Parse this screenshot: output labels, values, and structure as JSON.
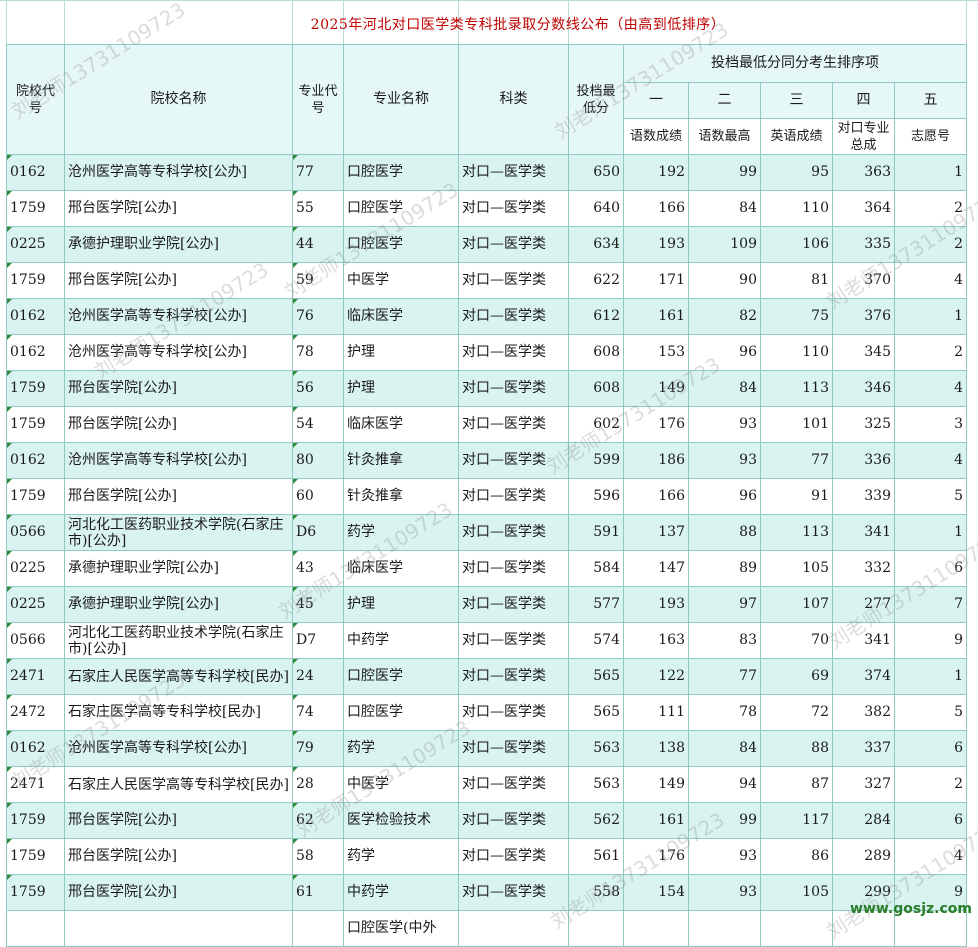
{
  "title": "2025年河北对口医学类专科批录取分数线公布（由高到低排序）",
  "header": {
    "school_code": "院校代号",
    "school_name": "院校名称",
    "major_code": "专业代号",
    "major_name": "专业名称",
    "subject": "科类",
    "min_score": "投档最低分",
    "tie_group": "投档最低分同分考生排序项",
    "orders": [
      "一",
      "二",
      "三",
      "四",
      "五"
    ],
    "order_items": [
      "语数成绩",
      "语数最高",
      "英语成绩",
      "对口专业总成",
      "志愿号"
    ]
  },
  "rows": [
    {
      "school_code": "0162",
      "school_name": "沧州医学高等专科学校[公办]",
      "major_code": "77",
      "major_name": "口腔医学",
      "subject": "对口—医学类",
      "min_score": "650",
      "c1": "192",
      "c2": "99",
      "c3": "95",
      "c4": "363",
      "c5": "1"
    },
    {
      "school_code": "1759",
      "school_name": "邢台医学院[公办]",
      "major_code": "55",
      "major_name": "口腔医学",
      "subject": "对口—医学类",
      "min_score": "640",
      "c1": "166",
      "c2": "84",
      "c3": "110",
      "c4": "364",
      "c5": "2"
    },
    {
      "school_code": "0225",
      "school_name": "承德护理职业学院[公办]",
      "major_code": "44",
      "major_name": "口腔医学",
      "subject": "对口—医学类",
      "min_score": "634",
      "c1": "193",
      "c2": "109",
      "c3": "106",
      "c4": "335",
      "c5": "2"
    },
    {
      "school_code": "1759",
      "school_name": "邢台医学院[公办]",
      "major_code": "59",
      "major_name": "中医学",
      "subject": "对口—医学类",
      "min_score": "622",
      "c1": "171",
      "c2": "90",
      "c3": "81",
      "c4": "370",
      "c5": "4"
    },
    {
      "school_code": "0162",
      "school_name": "沧州医学高等专科学校[公办]",
      "major_code": "76",
      "major_name": "临床医学",
      "subject": "对口—医学类",
      "min_score": "612",
      "c1": "161",
      "c2": "82",
      "c3": "75",
      "c4": "376",
      "c5": "1"
    },
    {
      "school_code": "0162",
      "school_name": "沧州医学高等专科学校[公办]",
      "major_code": "78",
      "major_name": "护理",
      "subject": "对口—医学类",
      "min_score": "608",
      "c1": "153",
      "c2": "96",
      "c3": "110",
      "c4": "345",
      "c5": "2"
    },
    {
      "school_code": "1759",
      "school_name": "邢台医学院[公办]",
      "major_code": "56",
      "major_name": "护理",
      "subject": "对口—医学类",
      "min_score": "608",
      "c1": "149",
      "c2": "84",
      "c3": "113",
      "c4": "346",
      "c5": "4"
    },
    {
      "school_code": "1759",
      "school_name": "邢台医学院[公办]",
      "major_code": "54",
      "major_name": "临床医学",
      "subject": "对口—医学类",
      "min_score": "602",
      "c1": "176",
      "c2": "93",
      "c3": "101",
      "c4": "325",
      "c5": "3"
    },
    {
      "school_code": "0162",
      "school_name": "沧州医学高等专科学校[公办]",
      "major_code": "80",
      "major_name": "针灸推拿",
      "subject": "对口—医学类",
      "min_score": "599",
      "c1": "186",
      "c2": "93",
      "c3": "77",
      "c4": "336",
      "c5": "4"
    },
    {
      "school_code": "1759",
      "school_name": "邢台医学院[公办]",
      "major_code": "60",
      "major_name": "针灸推拿",
      "subject": "对口—医学类",
      "min_score": "596",
      "c1": "166",
      "c2": "96",
      "c3": "91",
      "c4": "339",
      "c5": "5"
    },
    {
      "school_code": "0566",
      "school_name": "河北化工医药职业技术学院(石家庄市)[公办]",
      "major_code": "D6",
      "major_name": "药学",
      "subject": "对口—医学类",
      "min_score": "591",
      "c1": "137",
      "c2": "88",
      "c3": "113",
      "c4": "341",
      "c5": "1"
    },
    {
      "school_code": "0225",
      "school_name": "承德护理职业学院[公办]",
      "major_code": "43",
      "major_name": "临床医学",
      "subject": "对口—医学类",
      "min_score": "584",
      "c1": "147",
      "c2": "89",
      "c3": "105",
      "c4": "332",
      "c5": "6"
    },
    {
      "school_code": "0225",
      "school_name": "承德护理职业学院[公办]",
      "major_code": "45",
      "major_name": "护理",
      "subject": "对口—医学类",
      "min_score": "577",
      "c1": "193",
      "c2": "97",
      "c3": "107",
      "c4": "277",
      "c5": "7"
    },
    {
      "school_code": "0566",
      "school_name": "河北化工医药职业技术学院(石家庄市)[公办]",
      "major_code": "D7",
      "major_name": "中药学",
      "subject": "对口—医学类",
      "min_score": "574",
      "c1": "163",
      "c2": "83",
      "c3": "70",
      "c4": "341",
      "c5": "9"
    },
    {
      "school_code": "2471",
      "school_name": "石家庄人民医学高等专科学校[民办]",
      "major_code": "24",
      "major_name": "口腔医学",
      "subject": "对口—医学类",
      "min_score": "565",
      "c1": "122",
      "c2": "77",
      "c3": "69",
      "c4": "374",
      "c5": "1"
    },
    {
      "school_code": "2472",
      "school_name": "石家庄医学高等专科学校[民办]",
      "major_code": "74",
      "major_name": "口腔医学",
      "subject": "对口—医学类",
      "min_score": "565",
      "c1": "111",
      "c2": "78",
      "c3": "72",
      "c4": "382",
      "c5": "5"
    },
    {
      "school_code": "0162",
      "school_name": "沧州医学高等专科学校[公办]",
      "major_code": "79",
      "major_name": "药学",
      "subject": "对口—医学类",
      "min_score": "563",
      "c1": "138",
      "c2": "84",
      "c3": "88",
      "c4": "337",
      "c5": "6"
    },
    {
      "school_code": "2471",
      "school_name": "石家庄人民医学高等专科学校[民办]",
      "major_code": "28",
      "major_name": "中医学",
      "subject": "对口—医学类",
      "min_score": "563",
      "c1": "149",
      "c2": "94",
      "c3": "87",
      "c4": "327",
      "c5": "2"
    },
    {
      "school_code": "1759",
      "school_name": "邢台医学院[公办]",
      "major_code": "62",
      "major_name": "医学检验技术",
      "subject": "对口—医学类",
      "min_score": "562",
      "c1": "161",
      "c2": "99",
      "c3": "117",
      "c4": "284",
      "c5": "6"
    },
    {
      "school_code": "1759",
      "school_name": "邢台医学院[公办]",
      "major_code": "58",
      "major_name": "药学",
      "subject": "对口—医学类",
      "min_score": "561",
      "c1": "176",
      "c2": "93",
      "c3": "86",
      "c4": "289",
      "c5": "4"
    },
    {
      "school_code": "1759",
      "school_name": "邢台医学院[公办]",
      "major_code": "61",
      "major_name": "中药学",
      "subject": "对口—医学类",
      "min_score": "558",
      "c1": "154",
      "c2": "93",
      "c3": "105",
      "c4": "299",
      "c5": "9"
    },
    {
      "school_code": "",
      "school_name": "",
      "major_code": "",
      "major_name": "口腔医学(中外",
      "subject": "",
      "min_score": "",
      "c1": "",
      "c2": "",
      "c3": "",
      "c4": "",
      "c5": ""
    }
  ],
  "watermark": "刘老师13731109723",
  "site": "www.gosjz.com"
}
